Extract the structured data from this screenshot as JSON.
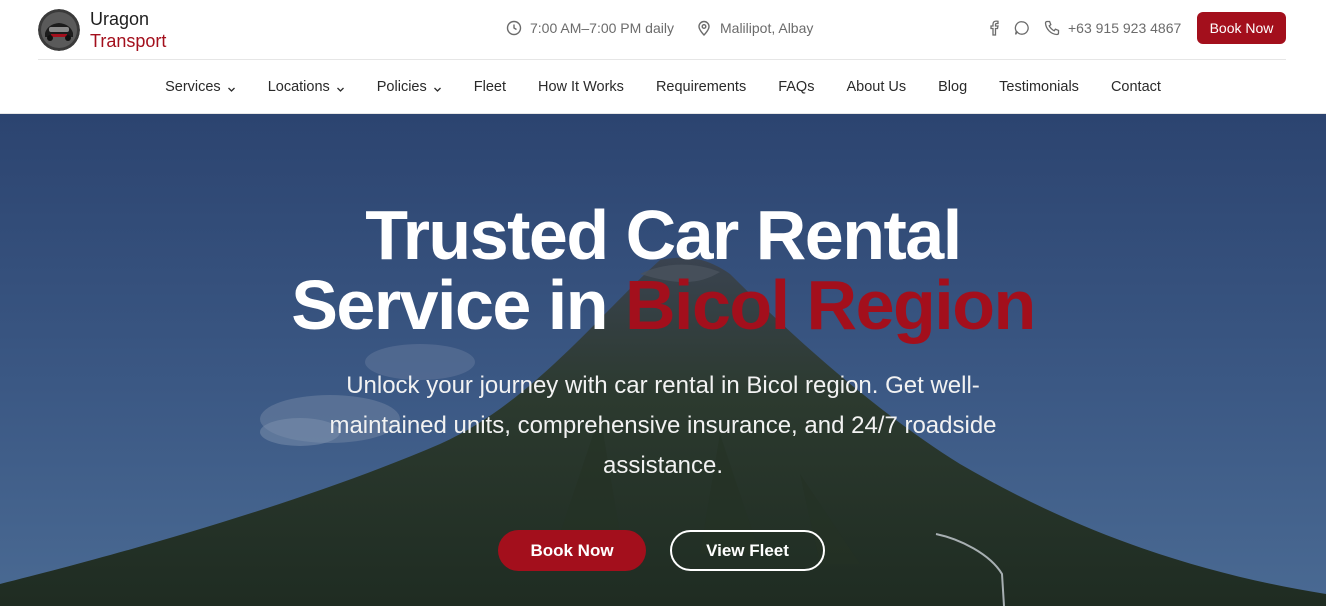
{
  "brand": {
    "name": "Uragon",
    "sub": "Transport",
    "logo_icon": "car-logo-icon"
  },
  "topbar": {
    "hours": "7:00 AM–7:00 PM daily",
    "location": "Malilipot, Albay",
    "phone": "+63 915 923 4867",
    "book_label": "Book Now",
    "icons": [
      "clock-icon",
      "map-pin-icon",
      "facebook-icon",
      "chat-icon",
      "phone-icon"
    ]
  },
  "nav": {
    "items": [
      {
        "label": "Services",
        "dropdown": true
      },
      {
        "label": "Locations",
        "dropdown": true
      },
      {
        "label": "Policies",
        "dropdown": true
      },
      {
        "label": "Fleet",
        "dropdown": false
      },
      {
        "label": "How It Works",
        "dropdown": false
      },
      {
        "label": "Requirements",
        "dropdown": false
      },
      {
        "label": "FAQs",
        "dropdown": false
      },
      {
        "label": "About Us",
        "dropdown": false
      },
      {
        "label": "Blog",
        "dropdown": false
      },
      {
        "label": "Testimonials",
        "dropdown": false
      },
      {
        "label": "Contact",
        "dropdown": false
      }
    ]
  },
  "hero": {
    "title_line1": "Trusted Car Rental",
    "title_line2_pre": "Service in ",
    "title_line2_highlight": "Bicol Region",
    "subtitle": "Unlock your journey with car rental in Bicol region. Get well-maintained units, comprehensive insurance, and 24/7 roadside assistance.",
    "cta_primary": "Book Now",
    "cta_secondary": "View Fleet"
  },
  "colors": {
    "accent": "#a30f1c",
    "hero_overlay": "#35507b",
    "text": "#1f1f1f",
    "muted": "#6b6b6b"
  }
}
